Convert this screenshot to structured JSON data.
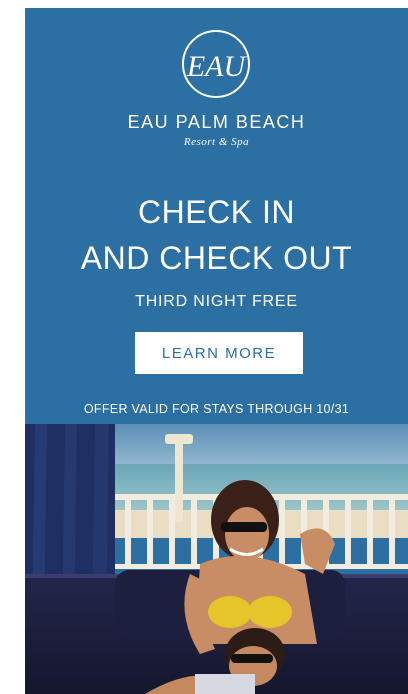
{
  "brand": {
    "name": "EAU PALM BEACH",
    "tagline": "Resort & Spa",
    "logo_monogram": "EAU"
  },
  "headline": {
    "line1": "CHECK IN",
    "line2": "AND CHECK OUT"
  },
  "subheadline": "THIRD NIGHT FREE",
  "cta": {
    "label": "LEARN MORE"
  },
  "offer_note": "OFFER VALID FOR STAYS THROUGH 10/31",
  "colors": {
    "background": "#2b6fa3",
    "text": "#ffffff",
    "button_bg": "#ffffff",
    "button_text": "#2b6fa3"
  }
}
